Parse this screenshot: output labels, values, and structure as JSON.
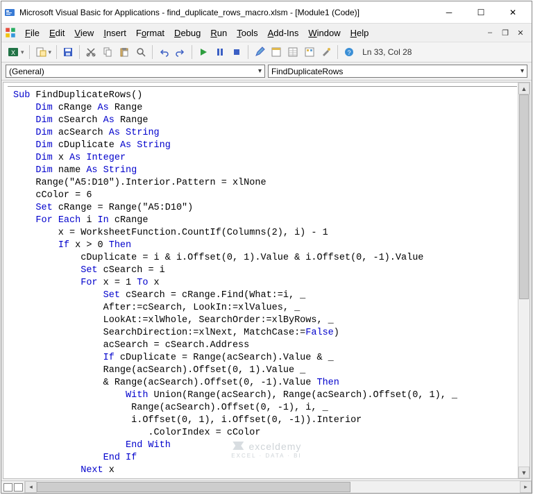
{
  "window": {
    "title": "Microsoft Visual Basic for Applications - find_duplicate_rows_macro.xlsm - [Module1 (Code)]"
  },
  "menu": {
    "items": [
      {
        "accel": "F",
        "rest": "ile"
      },
      {
        "accel": "E",
        "rest": "dit"
      },
      {
        "accel": "V",
        "rest": "iew"
      },
      {
        "accel": "I",
        "rest": "nsert"
      },
      {
        "accel": "",
        "rest": "F",
        "accel2": "o",
        "rest2": "rmat"
      },
      {
        "accel": "D",
        "rest": "ebug"
      },
      {
        "accel": "R",
        "rest": "un"
      },
      {
        "accel": "T",
        "rest": "ools"
      },
      {
        "accel": "A",
        "rest": "dd-Ins"
      },
      {
        "accel": "W",
        "rest": "indow"
      },
      {
        "accel": "H",
        "rest": "elp"
      }
    ]
  },
  "toolbar": {
    "status": "Ln 33, Col 28"
  },
  "dropdowns": {
    "left": "(General)",
    "right": "FindDuplicateRows"
  },
  "code": {
    "tokens": [
      [
        [
          "kw",
          "Sub"
        ],
        [
          "",
          " FindDuplicateRows()"
        ]
      ],
      [
        [
          "",
          "    "
        ],
        [
          "kw",
          "Dim"
        ],
        [
          "",
          " cRange "
        ],
        [
          "kw",
          "As"
        ],
        [
          "",
          " Range"
        ]
      ],
      [
        [
          "",
          "    "
        ],
        [
          "kw",
          "Dim"
        ],
        [
          "",
          " cSearch "
        ],
        [
          "kw",
          "As"
        ],
        [
          "",
          " Range"
        ]
      ],
      [
        [
          "",
          "    "
        ],
        [
          "kw",
          "Dim"
        ],
        [
          "",
          " acSearch "
        ],
        [
          "kw",
          "As"
        ],
        [
          "",
          " "
        ],
        [
          "kw",
          "String"
        ]
      ],
      [
        [
          "",
          "    "
        ],
        [
          "kw",
          "Dim"
        ],
        [
          "",
          " cDuplicate "
        ],
        [
          "kw",
          "As"
        ],
        [
          "",
          " "
        ],
        [
          "kw",
          "String"
        ]
      ],
      [
        [
          "",
          "    "
        ],
        [
          "kw",
          "Dim"
        ],
        [
          "",
          " x "
        ],
        [
          "kw",
          "As"
        ],
        [
          "",
          " "
        ],
        [
          "kw",
          "Integer"
        ]
      ],
      [
        [
          "",
          "    "
        ],
        [
          "kw",
          "Dim"
        ],
        [
          "",
          " name "
        ],
        [
          "kw",
          "As"
        ],
        [
          "",
          " "
        ],
        [
          "kw",
          "String"
        ]
      ],
      [
        [
          "",
          "    Range(\"A5:D10\").Interior.Pattern = xlNone"
        ]
      ],
      [
        [
          "",
          "    cColor = 6"
        ]
      ],
      [
        [
          "",
          "    "
        ],
        [
          "kw",
          "Set"
        ],
        [
          "",
          " cRange = Range(\"A5:D10\")"
        ]
      ],
      [
        [
          "",
          "    "
        ],
        [
          "kw",
          "For"
        ],
        [
          "",
          " "
        ],
        [
          "kw",
          "Each"
        ],
        [
          "",
          " i "
        ],
        [
          "kw",
          "In"
        ],
        [
          "",
          " cRange"
        ]
      ],
      [
        [
          "",
          "        x = WorksheetFunction.CountIf(Columns(2), i) - 1"
        ]
      ],
      [
        [
          "",
          "        "
        ],
        [
          "kw",
          "If"
        ],
        [
          "",
          " x > 0 "
        ],
        [
          "kw",
          "Then"
        ]
      ],
      [
        [
          "",
          "            cDuplicate = i & i.Offset(0, 1).Value & i.Offset(0, -1).Value"
        ]
      ],
      [
        [
          "",
          "            "
        ],
        [
          "kw",
          "Set"
        ],
        [
          "",
          " cSearch = i"
        ]
      ],
      [
        [
          "",
          "            "
        ],
        [
          "kw",
          "For"
        ],
        [
          "",
          " x = 1 "
        ],
        [
          "kw",
          "To"
        ],
        [
          "",
          " x"
        ]
      ],
      [
        [
          "",
          "                "
        ],
        [
          "kw",
          "Set"
        ],
        [
          "",
          " cSearch = cRange.Find(What:=i, _"
        ]
      ],
      [
        [
          "",
          "                After:=cSearch, LookIn:=xlValues, _"
        ]
      ],
      [
        [
          "",
          "                LookAt:=xlWhole, SearchOrder:=xlByRows, _"
        ]
      ],
      [
        [
          "",
          "                SearchDirection:=xlNext, MatchCase:="
        ],
        [
          "kw",
          "False"
        ],
        [
          "",
          ")"
        ]
      ],
      [
        [
          "",
          "                acSearch = cSearch.Address"
        ]
      ],
      [
        [
          "",
          "                "
        ],
        [
          "kw",
          "If"
        ],
        [
          "",
          " cDuplicate = Range(acSearch).Value & _"
        ]
      ],
      [
        [
          "",
          "                Range(acSearch).Offset(0, 1).Value _"
        ]
      ],
      [
        [
          "",
          "                & Range(acSearch).Offset(0, -1).Value "
        ],
        [
          "kw",
          "Then"
        ]
      ],
      [
        [
          "",
          "                    "
        ],
        [
          "kw",
          "With"
        ],
        [
          "",
          " Union(Range(acSearch), Range(acSearch).Offset(0, 1), _"
        ]
      ],
      [
        [
          "",
          "                     Range(acSearch).Offset(0, -1), i, _"
        ]
      ],
      [
        [
          "",
          "                     i.Offset(0, 1), i.Offset(0, -1)).Interior"
        ]
      ],
      [
        [
          "",
          "                        .ColorIndex = cColor"
        ]
      ],
      [
        [
          "",
          "                    "
        ],
        [
          "kw",
          "End With"
        ]
      ],
      [
        [
          "",
          "                "
        ],
        [
          "kw",
          "End If"
        ]
      ],
      [
        [
          "",
          "            "
        ],
        [
          "kw",
          "Next"
        ],
        [
          "",
          " x"
        ]
      ]
    ]
  },
  "watermark": {
    "main": "exceldemy",
    "sub": "EXCEL · DATA · BI"
  }
}
